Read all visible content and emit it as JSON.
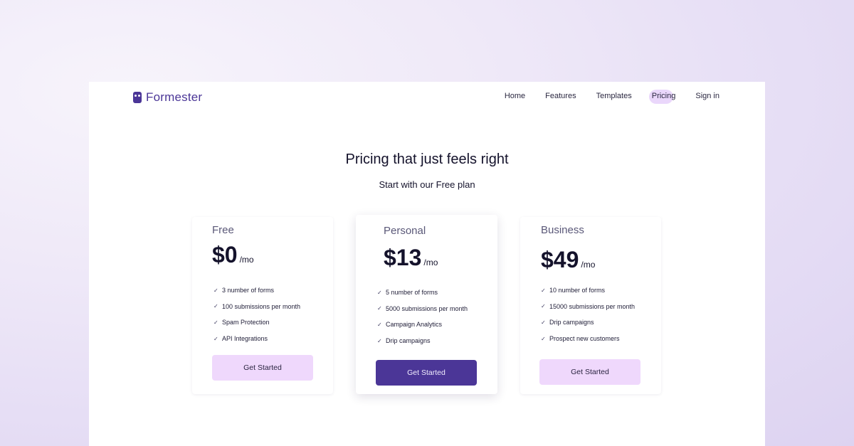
{
  "brand": {
    "name": "Formester"
  },
  "nav": {
    "links": [
      "Home",
      "Features",
      "Templates",
      "Pricing",
      "Sign in"
    ],
    "active": "Pricing"
  },
  "hero": {
    "title": "Pricing that just feels right",
    "subtitle": "Start with our Free plan"
  },
  "plans": [
    {
      "name": "Free",
      "price": "$0",
      "per": "/mo",
      "features": [
        "3 number of forms",
        "100 submissions per month",
        "Spam Protection",
        "API Integrations"
      ],
      "cta": "Get Started"
    },
    {
      "name": "Personal",
      "price": "$13",
      "per": "/mo",
      "features": [
        "5 number of forms",
        "5000 submissions per month",
        "Campaign Analytics",
        "Drip campaigns"
      ],
      "cta": "Get Started"
    },
    {
      "name": "Business",
      "price": "$49",
      "per": "/mo",
      "features": [
        "10 number of forms",
        "15000 submissions per month",
        "Drip campaigns",
        "Prospect new customers"
      ],
      "cta": "Get Started"
    }
  ],
  "colors": {
    "brand": "#4b3697",
    "button_light": "#efd8fc",
    "nav_active_highlight": "#ead7fb"
  },
  "icons": {
    "check": "check-icon",
    "logo": "formester-logo-icon"
  }
}
